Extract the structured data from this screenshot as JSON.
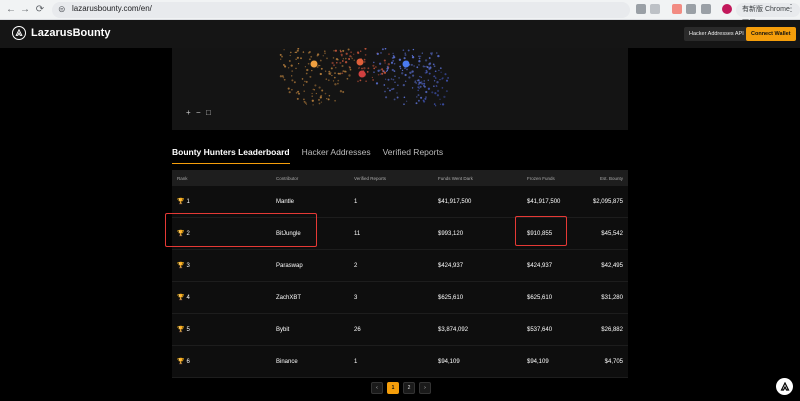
{
  "browser": {
    "url": "lazarusbounty.com/en/",
    "update_label": "有新版 Chrome 可用",
    "nav_back": "←",
    "nav_forward": "→",
    "nav_reload": "⟳",
    "tune_icon": "⊜",
    "menu": "⋮"
  },
  "header": {
    "brand": "LazarusBounty",
    "api_button": "Hacker Addresses API",
    "wallet_button": "Connect Wallet"
  },
  "graph": {
    "zoom_in": "+",
    "zoom_out": "−",
    "fit": "□"
  },
  "tabs": [
    {
      "label": "Bounty Hunters Leaderboard",
      "active": true
    },
    {
      "label": "Hacker Addresses",
      "active": false
    },
    {
      "label": "Verified Reports",
      "active": false
    }
  ],
  "table": {
    "columns": {
      "rank": "Rank",
      "contributor": "Contributor",
      "reports": "Verified Reports",
      "funds": "Funds Went Dark",
      "frozen": "Frozen Funds",
      "bounty": "Est. Bounty"
    },
    "trophy": "🏆",
    "rows": [
      {
        "rank": "1",
        "contributor": "Mantle",
        "reports": "1",
        "funds": "$41,917,500",
        "frozen": "$41,917,500",
        "bounty": "$2,095,875"
      },
      {
        "rank": "2",
        "contributor": "BitJungle",
        "reports": "11",
        "funds": "$993,120",
        "frozen": "$910,855",
        "bounty": "$45,542"
      },
      {
        "rank": "3",
        "contributor": "Paraswap",
        "reports": "2",
        "funds": "$424,937",
        "frozen": "$424,937",
        "bounty": "$42,495"
      },
      {
        "rank": "4",
        "contributor": "ZachXBT",
        "reports": "3",
        "funds": "$625,610",
        "frozen": "$625,610",
        "bounty": "$31,280"
      },
      {
        "rank": "5",
        "contributor": "Bybit",
        "reports": "26",
        "funds": "$3,874,092",
        "frozen": "$537,640",
        "bounty": "$26,882"
      },
      {
        "rank": "6",
        "contributor": "Binance",
        "reports": "1",
        "funds": "$94,109",
        "frozen": "$94,109",
        "bounty": "$4,705"
      }
    ]
  },
  "pagination": {
    "prev": "‹",
    "pages": [
      "1",
      "2"
    ],
    "current": "1",
    "next": "›"
  },
  "colors": {
    "accent": "#f59e0b",
    "annotation": "#e53935"
  }
}
